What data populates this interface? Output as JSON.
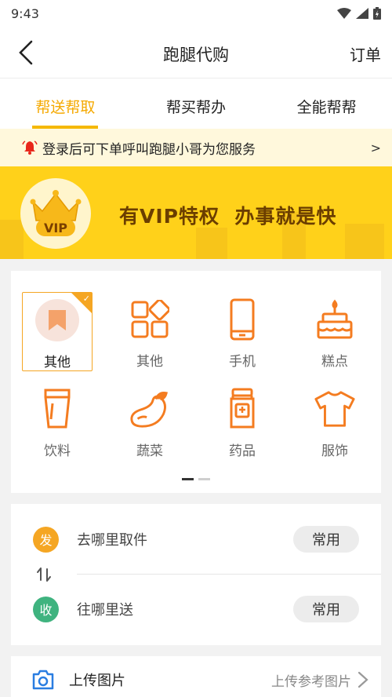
{
  "status_bar": {
    "time": "9:43"
  },
  "nav": {
    "title": "跑腿代购",
    "orders_label": "订单"
  },
  "tabs": [
    {
      "label": "帮送帮取",
      "active": true
    },
    {
      "label": "帮买帮办",
      "active": false
    },
    {
      "label": "全能帮帮",
      "active": false
    }
  ],
  "notice": {
    "text": "登录后可下单呼叫跑腿小哥为您服务",
    "arrow": ">"
  },
  "banner": {
    "slogan": "有VIP特权  办事就是快",
    "badge_text": "VIP"
  },
  "categories": [
    {
      "label": "其他",
      "icon": "bookmark-icon",
      "selected": true
    },
    {
      "label": "其他",
      "icon": "grid-apps-icon",
      "selected": false
    },
    {
      "label": "手机",
      "icon": "phone-icon",
      "selected": false
    },
    {
      "label": "糕点",
      "icon": "cake-icon",
      "selected": false
    },
    {
      "label": "饮料",
      "icon": "cup-icon",
      "selected": false
    },
    {
      "label": "蔬菜",
      "icon": "eggplant-icon",
      "selected": false
    },
    {
      "label": "药品",
      "icon": "medicine-bottle-icon",
      "selected": false
    },
    {
      "label": "服饰",
      "icon": "tshirt-icon",
      "selected": false
    }
  ],
  "pager": {
    "total": 2,
    "current": 1
  },
  "route": {
    "pickup": {
      "badge": "发",
      "placeholder": "去哪里取件",
      "common_label": "常用"
    },
    "dropoff": {
      "badge": "收",
      "placeholder": "往哪里送",
      "common_label": "常用"
    }
  },
  "upload": {
    "label": "上传图片",
    "hint": "上传参考图片"
  },
  "colors": {
    "accent": "#f5a900",
    "banner": "#ffd11a",
    "pickup": "#f5a623",
    "dropoff": "#3fb37f",
    "icon_orange": "#f47c20"
  }
}
